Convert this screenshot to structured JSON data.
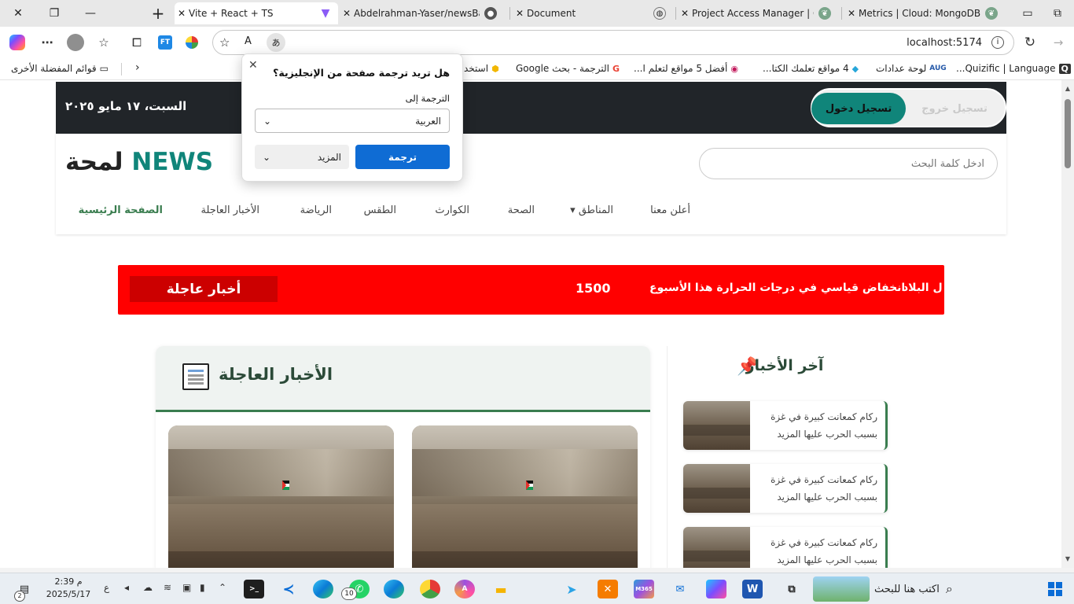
{
  "window": {
    "minimize": "—",
    "restore": "❐",
    "close": "✕",
    "new_tab": "+"
  },
  "tabs": [
    {
      "title": "Vite + React + TS",
      "active": true
    },
    {
      "title": "Abdelrahman-Yaser/newsBac",
      "active": false
    },
    {
      "title": "Document",
      "active": false
    },
    {
      "title": "Project Access Manager | Clo",
      "active": false
    },
    {
      "title": "Metrics | Cloud: MongoDB Cl",
      "active": false
    }
  ],
  "address": {
    "url": "localhost:5174",
    "read_aloud": "A",
    "translate": "あ"
  },
  "favorites": {
    "other": "قوائم المفضلة الأخرى",
    "items": [
      {
        "label": "Quizific | Language...",
        "icon": "Q"
      },
      {
        "label": "لوحة عدادات",
        "icon": "AUG"
      },
      {
        "label": "4 مواقع تعلمك الكتا...",
        "icon": "◆"
      },
      {
        "label": "أفضل 5 مواقع لتعلم ا...",
        "icon": "◉"
      },
      {
        "label": "الترجمة - بحث Google",
        "icon": "G"
      },
      {
        "label": "استخد",
        "icon": "⬢"
      }
    ]
  },
  "site": {
    "auth": {
      "login": "تسجيل دخول",
      "logout": "تسجيل خروج"
    },
    "date": "السبت، ١٧ مايو ٢٠٢٥",
    "search_placeholder": "ادخل كلمة البحث",
    "logo": {
      "news": "NEWS",
      "ar": "لمحة"
    },
    "nav": [
      {
        "label": "الصفحة الرئيسية",
        "active": true
      },
      {
        "label": "الأخبار العاجلة"
      },
      {
        "label": "الرياضة"
      },
      {
        "label": "الطقس"
      },
      {
        "label": "الكوارث"
      },
      {
        "label": "الصحة"
      },
      {
        "label": "المناطق ▾"
      },
      {
        "label": "أعلن معنا"
      }
    ],
    "ticker": {
      "label": "أخبار عاجلة",
      "items": [
        "انخفاض قياسي في درجات الحرارة هذا الأسبوع",
        "1500",
        "ل البلاد"
      ]
    },
    "breaking": {
      "title": "الأخبار العاجلة"
    },
    "latest": {
      "title": "آخر الأخبار",
      "items": [
        {
          "line1": "ركام كمعانت كبيرة في غزة",
          "line2": "بسبب الحرب عليها المزيد"
        },
        {
          "line1": "ركام كمعانت كبيرة في غزة",
          "line2": "بسبب الحرب عليها المزيد"
        },
        {
          "line1": "ركام كمعانت كبيرة في غزة",
          "line2": "بسبب الحرب عليها المزيد"
        }
      ]
    }
  },
  "translate_popup": {
    "title": "هل تريد ترجمة صفحة من الإنجليزية؟",
    "label": "الترجمة إلى",
    "language": "العربية",
    "translate_button": "ترجمة",
    "more_button": "المزيد"
  },
  "taskbar": {
    "search_placeholder": "اكتب هنا للبحث",
    "time": "2:39 م",
    "date": "2025/5/17",
    "lang": "ع",
    "notification_count": "2",
    "badge_count": "10"
  },
  "colors": {
    "accent": "#10857a",
    "ticker": "#ff0000",
    "brand_green": "#3a7d4f",
    "edge_blue": "#0f6cd4"
  }
}
